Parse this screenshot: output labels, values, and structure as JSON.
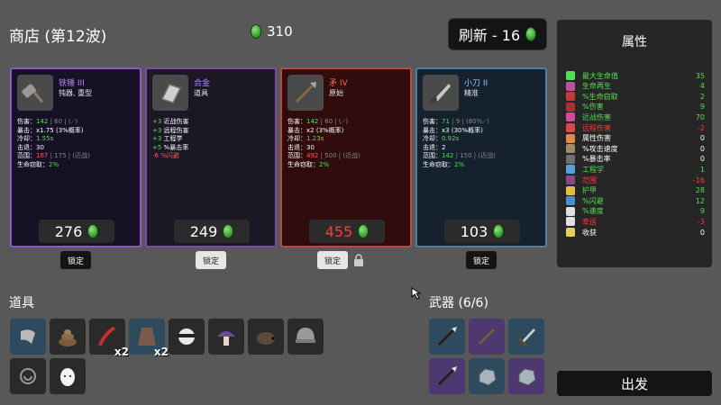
{
  "header": {
    "shop_title": "商店 (第12波)",
    "materials": "310",
    "reroll_label": "刷新 - 16"
  },
  "shop": [
    {
      "name": "铁锤 III",
      "type": "钝器, 重型",
      "icon": "hammer-icon",
      "stats": [
        {
          "label": "伤害：",
          "value": "142",
          "extra": " | 60 | (⟋)"
        },
        {
          "label": "暴击：",
          "value": "x1.75",
          "extra": " (3%概率)"
        },
        {
          "label": "冷却：",
          "value": "1.55s",
          "extra": ""
        },
        {
          "label": "击退：",
          "value": "30",
          "extra": ""
        },
        {
          "label": "范围：",
          "value": "167",
          "extra": " | 175 | (近战)"
        },
        {
          "label": "生命窃取：",
          "value": "2%",
          "extra": ""
        }
      ],
      "price": "276",
      "lock_label": "锁定"
    },
    {
      "name": "合金",
      "type": "道具",
      "icon": "alloy-icon",
      "stats": [
        {
          "label": "+3 ",
          "value": "近战伤害"
        },
        {
          "label": "+3 ",
          "value": "远程伤害"
        },
        {
          "label": "+3 ",
          "value": "工程学"
        },
        {
          "label": "+5 ",
          "value": "%暴击率"
        },
        {
          "label": "-6 ",
          "value": "%闪避"
        }
      ],
      "price": "249",
      "lock_label": "锁定"
    },
    {
      "name": "矛 IV",
      "type": "原始",
      "icon": "spear-icon",
      "stats": [
        {
          "label": "伤害：",
          "value": "142",
          "extra": " | 60 | (⟋)"
        },
        {
          "label": "暴击：",
          "value": "x2",
          "extra": " (3%概率)"
        },
        {
          "label": "冷却：",
          "value": "1.23s",
          "extra": ""
        },
        {
          "label": "击退：",
          "value": "30",
          "extra": ""
        },
        {
          "label": "范围：",
          "value": "492",
          "extra": " | 500 | (近战)"
        },
        {
          "label": "生命窃取：",
          "value": "2%",
          "extra": ""
        }
      ],
      "price": "455",
      "lock_label": "锁定"
    },
    {
      "name": "小刀 II",
      "type": "精准",
      "icon": "knife-icon",
      "stats": [
        {
          "label": "伤害：",
          "value": "71",
          "extra": " | 9 | (80%⟋)"
        },
        {
          "label": "暴击：",
          "value": "x3",
          "extra": " (30%概率)"
        },
        {
          "label": "冷却：",
          "value": "0.92s",
          "extra": ""
        },
        {
          "label": "击退：",
          "value": "2",
          "extra": ""
        },
        {
          "label": "范围：",
          "value": "142",
          "extra": " | 150 | (近战)"
        },
        {
          "label": "生命窃取：",
          "value": "2%",
          "extra": ""
        }
      ],
      "price": "103",
      "lock_label": "锁定"
    }
  ],
  "items_title": "道具",
  "items": [
    {
      "icon": "scarf-icon",
      "count": ""
    },
    {
      "icon": "poop-icon",
      "count": ""
    },
    {
      "icon": "red-tentacle-icon",
      "count": "x2"
    },
    {
      "icon": "coat-icon",
      "count": "x2"
    },
    {
      "icon": "ninja-icon",
      "count": ""
    },
    {
      "icon": "mushroom-icon",
      "count": ""
    },
    {
      "icon": "hedgehog-icon",
      "count": ""
    },
    {
      "icon": "helmet-icon",
      "count": ""
    },
    {
      "icon": "snail-icon",
      "count": ""
    },
    {
      "icon": "egg-icon",
      "count": ""
    }
  ],
  "weapons_title": "武器 (6/6)",
  "weapons": [
    {
      "icon": "spear-icon"
    },
    {
      "icon": "stick-icon"
    },
    {
      "icon": "sword-icon"
    },
    {
      "icon": "spear-icon"
    },
    {
      "icon": "rock-icon"
    },
    {
      "icon": "rock-icon"
    }
  ],
  "stats_panel": {
    "title": "属性",
    "rows": [
      {
        "label": "最大生命值",
        "value": "35",
        "color": "#52e052",
        "icon_color": "#52e052"
      },
      {
        "label": "生命再生",
        "value": "4",
        "color": "#52e052",
        "icon_color": "#c04fa0"
      },
      {
        "label": "%生命窃取",
        "value": "2",
        "color": "#52e052",
        "icon_color": "#c23a3a"
      },
      {
        "label": "%伤害",
        "value": "9",
        "color": "#52e052",
        "icon_color": "#b03030"
      },
      {
        "label": "近战伤害",
        "value": "70",
        "color": "#52e052",
        "icon_color": "#d24a9a"
      },
      {
        "label": "远程伤害",
        "value": "-2",
        "color": "#ff3a3a",
        "icon_color": "#d84a4a"
      },
      {
        "label": "属性伤害",
        "value": "0",
        "color": "#ffffff",
        "icon_color": "#e08a4a"
      },
      {
        "label": "%攻击速度",
        "value": "0",
        "color": "#ffffff",
        "icon_color": "#a08a6a"
      },
      {
        "label": "%暴击率",
        "value": "0",
        "color": "#ffffff",
        "icon_color": "#707070"
      },
      {
        "label": "工程学",
        "value": "1",
        "color": "#52e052",
        "icon_color": "#5aa0e0"
      },
      {
        "label": "范围",
        "value": "-16",
        "color": "#ff3a3a",
        "icon_color": "#8a4a8a"
      },
      {
        "label": "护甲",
        "value": "28",
        "color": "#52e052",
        "icon_color": "#e0c040"
      },
      {
        "label": "%闪避",
        "value": "12",
        "color": "#52e052",
        "icon_color": "#4a90d0"
      },
      {
        "label": "%速度",
        "value": "9",
        "color": "#52e052",
        "icon_color": "#e0e0e0"
      },
      {
        "label": "幸运",
        "value": "-3",
        "color": "#ff3a3a",
        "icon_color": "#e0e0e0"
      },
      {
        "label": "收获",
        "value": "0",
        "color": "#ffffff",
        "icon_color": "#e0d060"
      }
    ]
  },
  "go_label": "出发"
}
